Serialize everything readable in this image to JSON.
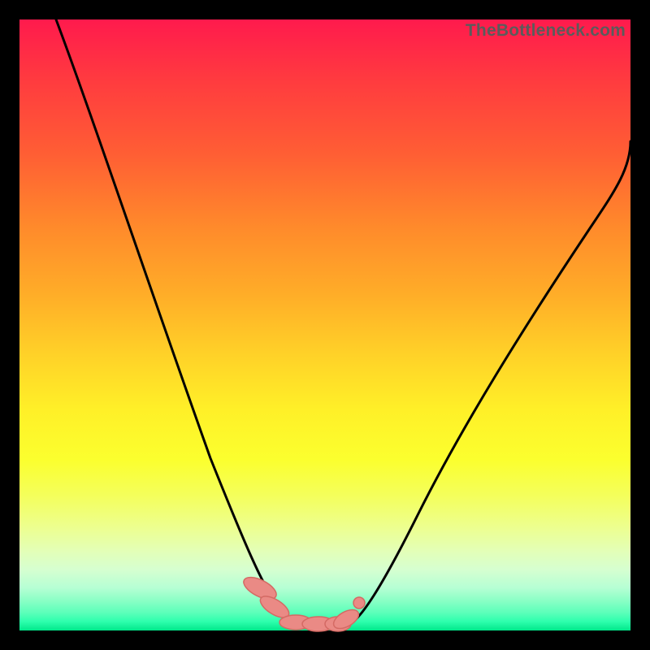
{
  "watermark": "TheBottleneck.com",
  "colors": {
    "curve": "#000000",
    "marker_fill": "#ea8a85",
    "marker_stroke": "#d46a64",
    "bg_top": "#ff1a4d",
    "bg_bottom": "#00e88a"
  },
  "chart_data": {
    "type": "line",
    "title": "",
    "xlabel": "",
    "ylabel": "",
    "xlim": [
      0,
      100
    ],
    "ylim": [
      0,
      100
    ],
    "note": "Axes are inferred percentage scales; values estimated from pixel positions. Lower y = better (green).",
    "series": [
      {
        "name": "left-curve",
        "x": [
          6,
          10,
          15,
          20,
          25,
          30,
          35,
          38,
          40,
          42,
          44,
          46
        ],
        "y": [
          100,
          88,
          74,
          60,
          46,
          32,
          18,
          10,
          6,
          3.5,
          2,
          1.5
        ]
      },
      {
        "name": "right-curve",
        "x": [
          53,
          55,
          58,
          62,
          68,
          75,
          82,
          90,
          100
        ],
        "y": [
          2,
          4,
          8,
          14,
          24,
          36,
          48,
          62,
          80
        ]
      },
      {
        "name": "optimal-band-markers",
        "marker": true,
        "x": [
          39,
          41,
          44,
          47,
          50,
          53,
          54.5
        ],
        "y": [
          6,
          3.5,
          2,
          1.6,
          1.5,
          1.8,
          3.2
        ]
      }
    ]
  }
}
